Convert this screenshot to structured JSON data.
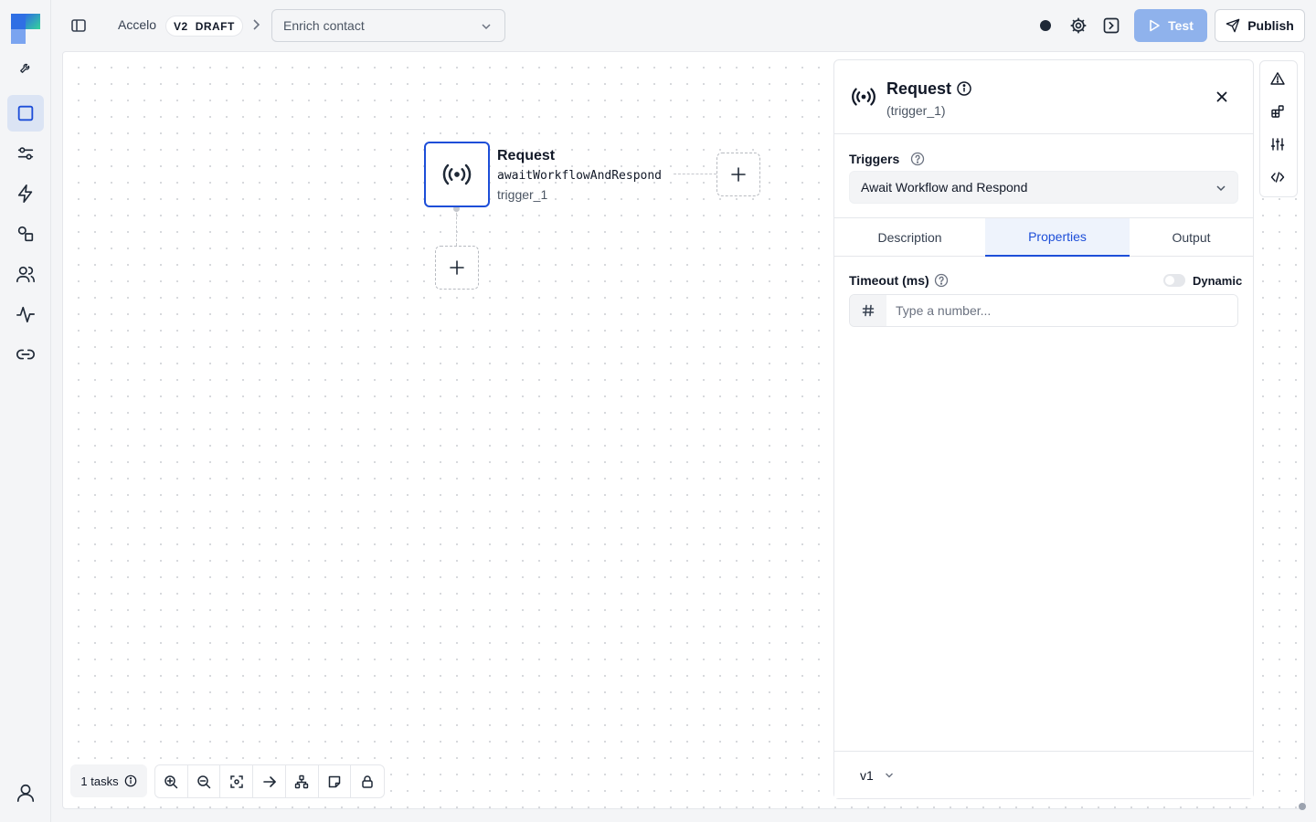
{
  "breadcrumb": {
    "project": "Accelo",
    "version": "V2",
    "status": "DRAFT",
    "workflow": "Enrich contact"
  },
  "toolbar": {
    "test_label": "Test",
    "publish_label": "Publish"
  },
  "node": {
    "title": "Request",
    "operation": "awaitWorkflowAndRespond",
    "id": "trigger_1"
  },
  "panel": {
    "title": "Request",
    "subtitle": "(trigger_1)",
    "triggers_label": "Triggers",
    "triggers_value": "Await Workflow and Respond",
    "tabs": [
      "Description",
      "Properties",
      "Output"
    ],
    "active_tab": "Properties",
    "timeout_label": "Timeout (ms)",
    "dynamic_label": "Dynamic",
    "timeout_placeholder": "Type a number...",
    "version": "v1"
  },
  "footer": {
    "tasks_label": "1 tasks"
  },
  "colors": {
    "accent": "#1d4ed8",
    "test_button": "#8fb2ec",
    "active_tab_bg": "#eef3fc"
  }
}
